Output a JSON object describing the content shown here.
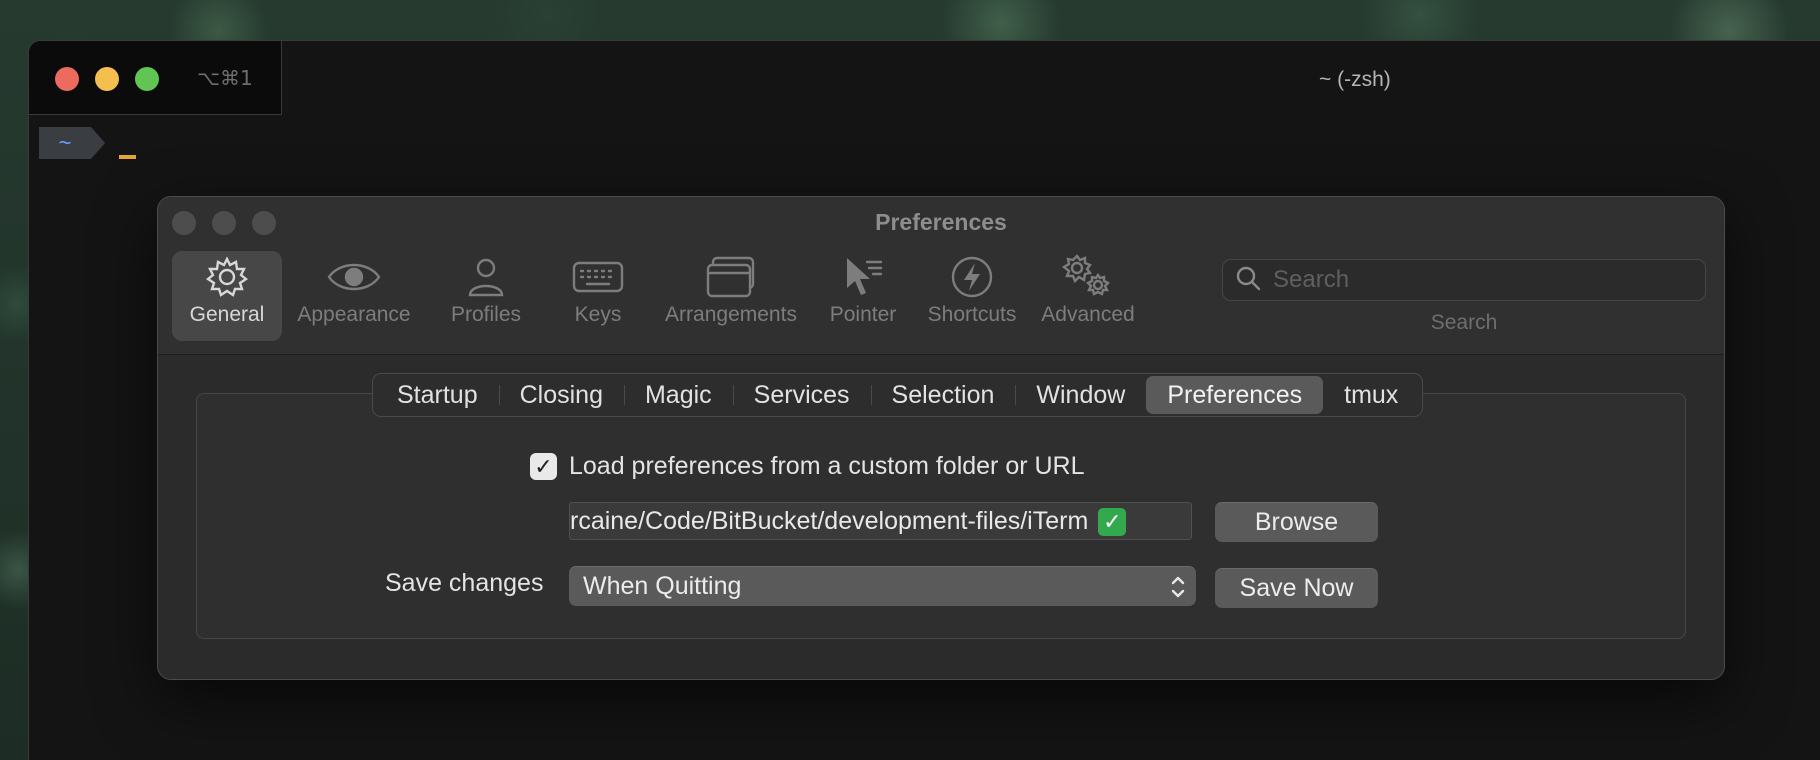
{
  "terminal": {
    "tab_shortcut": "⌥⌘1",
    "title": "~ (-zsh)",
    "prompt_dir": "~"
  },
  "preferences": {
    "title": "Preferences",
    "toolbar": [
      {
        "label": "General",
        "icon": "gear-icon",
        "active": true
      },
      {
        "label": "Appearance",
        "icon": "eye-icon",
        "active": false
      },
      {
        "label": "Profiles",
        "icon": "person-icon",
        "active": false
      },
      {
        "label": "Keys",
        "icon": "keyboard-icon",
        "active": false
      },
      {
        "label": "Arrangements",
        "icon": "windows-icon",
        "active": false
      },
      {
        "label": "Pointer",
        "icon": "pointer-icon",
        "active": false
      },
      {
        "label": "Shortcuts",
        "icon": "lightning-icon",
        "active": false
      },
      {
        "label": "Advanced",
        "icon": "gears-icon",
        "active": false
      }
    ],
    "search": {
      "placeholder": "Search",
      "label": "Search"
    },
    "tabs": [
      {
        "label": "Startup",
        "active": false
      },
      {
        "label": "Closing",
        "active": false
      },
      {
        "label": "Magic",
        "active": false
      },
      {
        "label": "Services",
        "active": false
      },
      {
        "label": "Selection",
        "active": false
      },
      {
        "label": "Window",
        "active": false
      },
      {
        "label": "Preferences",
        "active": true
      },
      {
        "label": "tmux",
        "active": false
      }
    ],
    "load_custom": {
      "label": "Load preferences from a custom folder or URL",
      "checked": true
    },
    "path_value": "rcaine/Code/BitBucket/development-files/iTerm",
    "path_status_icon": "green-check-icon",
    "browse_label": "Browse",
    "save_changes_label": "Save changes",
    "save_changes_value": "When Quitting",
    "save_now_label": "Save Now"
  },
  "colors": {
    "accent_prompt": "#6aa6ff",
    "cursor": "#e8a23a",
    "traffic_red": "#ec6a5e",
    "traffic_yellow": "#f4bf4f",
    "traffic_green": "#61c554"
  }
}
